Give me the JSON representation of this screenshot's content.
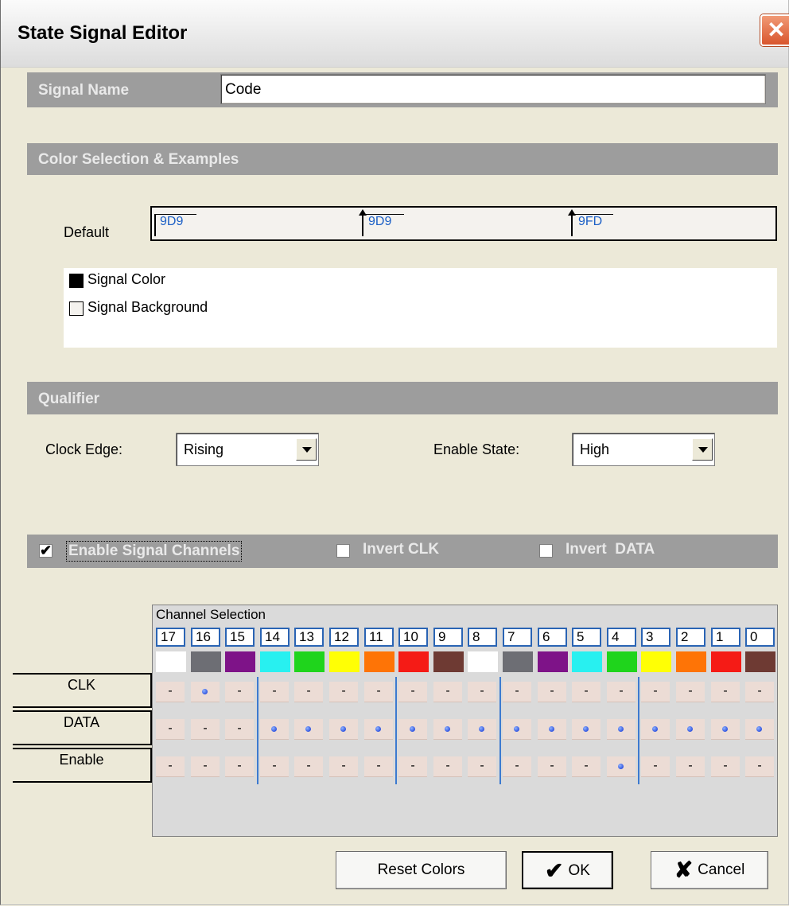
{
  "window": {
    "title": "State Signal Editor"
  },
  "signal_name": {
    "label": "Signal Name",
    "value": "Code"
  },
  "color_section": {
    "label": "Color Selection & Examples",
    "default_label": "Default",
    "examples": [
      "9D9",
      "9D9",
      "9FD"
    ],
    "legend": [
      {
        "label": "Signal Color",
        "color": "#000000"
      },
      {
        "label": "Signal Background",
        "color": "#f4f2ee"
      }
    ]
  },
  "qualifier": {
    "label": "Qualifier",
    "clock_edge_label": "Clock Edge:",
    "clock_edge_value": "Rising",
    "enable_state_label": "Enable State:",
    "enable_state_value": "High"
  },
  "channels_bar": {
    "enable_label": "Enable Signal Channels",
    "enable_checked": true,
    "invert_clk_label": "Invert CLK",
    "invert_clk_checked": false,
    "invert_data_label": "Invert  DATA",
    "invert_data_checked": false
  },
  "channel_grid": {
    "header": "Channel Selection",
    "channels": [
      "17",
      "16",
      "15",
      "14",
      "13",
      "12",
      "11",
      "10",
      "9",
      "8",
      "7",
      "6",
      "5",
      "4",
      "3",
      "2",
      "1",
      "0"
    ],
    "colors": [
      "#ffffff",
      "#6d6e74",
      "#7e1388",
      "#28f0f0",
      "#1fd41c",
      "#ffff05",
      "#fe7406",
      "#f51b16",
      "#6e3a33",
      "#ffffff",
      "#6d6e74",
      "#7e1388",
      "#28f0f0",
      "#1fd41c",
      "#ffff05",
      "#fe7406",
      "#f51b16",
      "#6e3a33"
    ],
    "rows": [
      {
        "label": "CLK",
        "cells": [
          "-",
          "dot",
          "-",
          "-",
          "-",
          "-",
          "-",
          "-",
          "-",
          "-",
          "-",
          "-",
          "-",
          "-",
          "-",
          "-",
          "-",
          "-"
        ]
      },
      {
        "label": "DATA",
        "cells": [
          "-",
          "-",
          "-",
          "dot",
          "dot",
          "dot",
          "dot",
          "dot",
          "dot",
          "dot",
          "dot",
          "dot",
          "dot",
          "dot",
          "dot",
          "dot",
          "dot",
          "dot"
        ]
      },
      {
        "label": "Enable",
        "cells": [
          "-",
          "-",
          "-",
          "-",
          "-",
          "-",
          "-",
          "-",
          "-",
          "-",
          "-",
          "-",
          "-",
          "dot",
          "-",
          "-",
          "-",
          "-"
        ]
      }
    ]
  },
  "buttons": {
    "reset": "Reset Colors",
    "ok": "OK",
    "cancel": "Cancel"
  }
}
